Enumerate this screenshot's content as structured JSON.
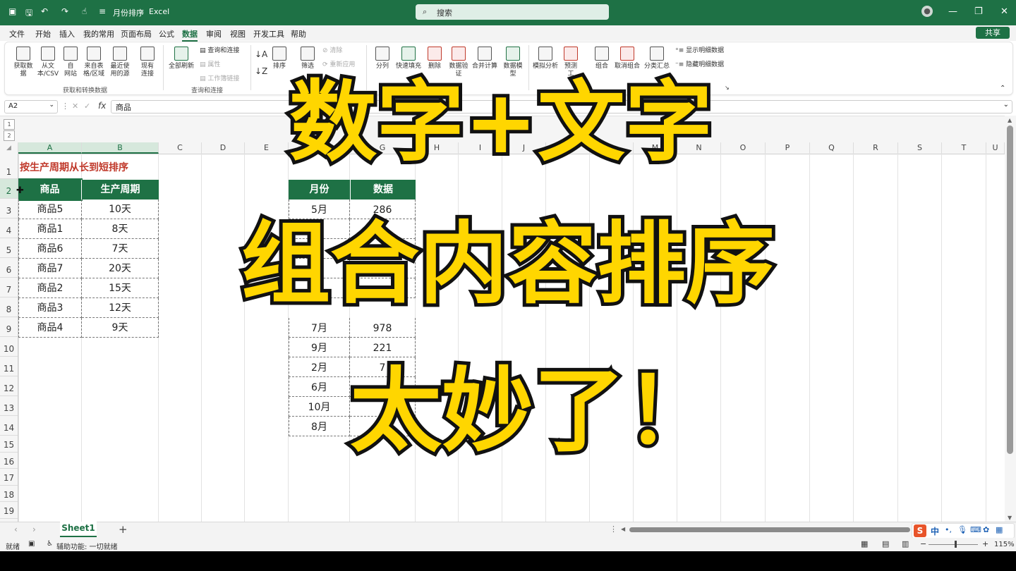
{
  "titlebar": {
    "doc_title": "月份排序",
    "app_name": "Excel",
    "search_placeholder": "搜索",
    "separator": "-"
  },
  "menu": [
    "文件",
    "开始",
    "插入",
    "我的常用",
    "页面布局",
    "公式",
    "数据",
    "审阅",
    "视图",
    "开发工具",
    "帮助"
  ],
  "share_label": "共享",
  "ribbon": {
    "get_data": "获取数\n据",
    "from_csv": "从文\n本/CSV",
    "from_web": "自\n网站",
    "from_table": "来自表\n格/区域",
    "recent_sources": "最近使\n用的源",
    "existing_conn": "现有\n连接",
    "group1_label": "获取和转换数据",
    "refresh_all": "全部刷新",
    "queries_conn": "查询和连接",
    "properties": "属性",
    "edit_links": "工作簿链接",
    "group2_label": "查询和连接",
    "sort": "排序",
    "filter": "筛选",
    "clear": "清除",
    "reapply": "重新应用",
    "split": "分列",
    "flash_fill": "快速填充",
    "remove_dup": "删除",
    "data_validation": "数据验\n证",
    "consolidate": "合并计算",
    "data_model": "数据模\n型",
    "whatif": "模拟分析",
    "forecast": "预测\n工",
    "group": "组合",
    "ungroup": "取消组合",
    "subtotal": "分类汇总",
    "show_detail": "显示明细数据",
    "hide_detail": "隐藏明细数据"
  },
  "formulabar": {
    "cell_ref": "A2",
    "fx": "fx",
    "content": "商品"
  },
  "columns": [
    "A",
    "B",
    "C",
    "D",
    "E",
    "F",
    "G",
    "H",
    "I",
    "J",
    "K",
    "L",
    "M",
    "N",
    "O",
    "P",
    "Q",
    "R",
    "S",
    "T",
    "U"
  ],
  "rows": [
    "1",
    "2",
    "3",
    "4",
    "5",
    "6",
    "7",
    "8",
    "9",
    "10",
    "11",
    "12",
    "13",
    "14",
    "15",
    "16",
    "17",
    "18",
    "19"
  ],
  "outline_levels": [
    "1",
    "2"
  ],
  "sheet": {
    "a1_title": "按生产周期从长到短排序",
    "table1_headers": [
      "商品",
      "生产周期"
    ],
    "table1_rows": [
      [
        "商品5",
        "10天"
      ],
      [
        "商品1",
        "8天"
      ],
      [
        "商品6",
        "7天"
      ],
      [
        "商品7",
        "20天"
      ],
      [
        "商品2",
        "15天"
      ],
      [
        "商品3",
        "12天"
      ],
      [
        "商品4",
        "9天"
      ]
    ],
    "table2_headers": [
      "月份",
      "数据"
    ],
    "table2_rows": [
      [
        "5月",
        "286"
      ],
      [
        "",
        ""
      ],
      [
        "",
        ""
      ],
      [
        "",
        ""
      ],
      [
        "",
        ""
      ],
      [
        "7月",
        "978"
      ],
      [
        "9月",
        "221"
      ],
      [
        "2月",
        "7"
      ],
      [
        "6月",
        ""
      ],
      [
        "10月",
        ""
      ],
      [
        "8月",
        ""
      ]
    ]
  },
  "overlay": {
    "line1": "数字+文字",
    "line2": "组合内容排序",
    "line3": "太妙了！"
  },
  "tabs": {
    "sheet_name": "Sheet1",
    "add": "+"
  },
  "status": {
    "ready": "就绪",
    "accessibility": "辅助功能: 一切就绪",
    "zoom": "115%"
  },
  "ime": {
    "brand": "S",
    "lang": "中"
  }
}
